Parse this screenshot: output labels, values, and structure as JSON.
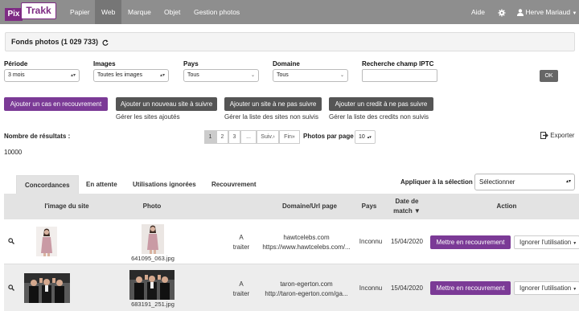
{
  "nav": {
    "logo_pix": "Pix",
    "logo_trakk": "Trakk",
    "items": [
      "Papier",
      "Web",
      "Marque",
      "Objet",
      "Gestion photos"
    ],
    "help": "Aide",
    "gear_icon": "gear-icon",
    "user_icon": "user-icon",
    "user": "Herve Mariaud"
  },
  "page": {
    "title": "Fonds photos (1 029 733)",
    "refresh_icon": "refresh-icon"
  },
  "filters": {
    "periode": {
      "label": "Période",
      "value": "3 mois"
    },
    "images": {
      "label": "Images",
      "value": "Toutes les images"
    },
    "pays": {
      "label": "Pays",
      "value": "Tous"
    },
    "domaine": {
      "label": "Domaine",
      "value": "Tous"
    },
    "iptc": {
      "label": "Recherche champ IPTC",
      "value": ""
    },
    "ok": "OK"
  },
  "actions": {
    "recouvrement": "Ajouter un cas en recouvrement",
    "site_suivre": "Ajouter un nouveau site à suivre",
    "site_suivre_link": "Gérer les sites ajoutés",
    "site_pas_suivre": "Ajouter un site à ne pas suivre",
    "site_pas_suivre_link": "Gérer la liste des sites non suivis",
    "credit_pas_suivre": "Ajouter un credit à ne pas suivre",
    "credit_pas_suivre_link": "Gérer la liste des credits non suivis"
  },
  "results": {
    "label": "Nombre de résultats :",
    "count": "10000",
    "pages": [
      "1",
      "2",
      "3",
      "...",
      "Suiv.",
      "Fin"
    ],
    "per_page_label": "Photos par page",
    "per_page": "10",
    "export": "Exporter",
    "export_icon": "export-icon"
  },
  "tabs": [
    "Concordances",
    "En attente",
    "Utilisations ignorées",
    "Recouvrement"
  ],
  "apply": {
    "label": "Appliquer à la sélection",
    "value": "Sélectionner"
  },
  "table": {
    "headers": {
      "site_image": "l'image du site",
      "photo": "Photo",
      "domain": "Domaine/Url page",
      "country": "Pays",
      "date_line1": "Date de",
      "date_line2": "match ▼",
      "action": "Action"
    },
    "rows": [
      {
        "photo_id": "641095_063.jpg",
        "status_line1": "A",
        "status_line2": "traiter",
        "domain": "hawtcelebs.com",
        "url": "https://www.hawtcelebs.com/...",
        "country": "Inconnu",
        "date": "15/04/2020",
        "btn_recouvrement": "Mettre en recouvrement",
        "btn_ignore": "Ignorer l'utilisation"
      },
      {
        "photo_id": "683191_251.jpg",
        "status_line1": "A",
        "status_line2": "traiter",
        "domain": "taron-egerton.com",
        "url": "http://taron-egerton.com/ga...",
        "country": "Inconnu",
        "date": "15/04/2020",
        "btn_recouvrement": "Mettre en recouvrement",
        "btn_ignore": "Ignorer l'utilisation"
      }
    ]
  },
  "colors": {
    "nav": "#8e8e8e",
    "accent": "#7b3a96",
    "dark_btn": "#555555"
  }
}
